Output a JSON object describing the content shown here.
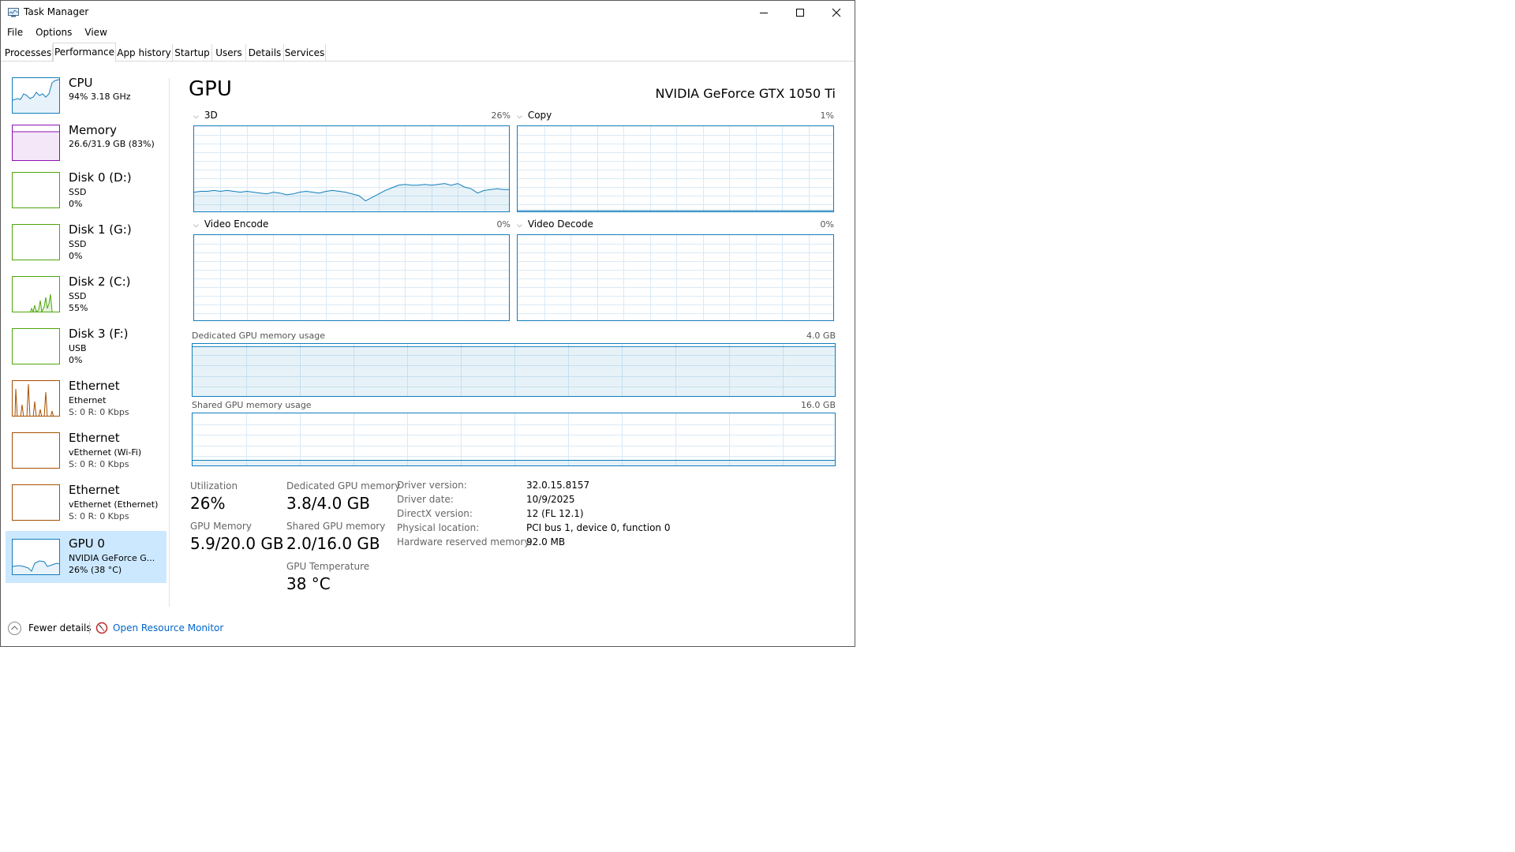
{
  "window": {
    "title": "Task Manager",
    "accent_color": "#117dbb",
    "icons": {
      "app": "task-manager-icon",
      "minimize": "minimize-icon",
      "maximize": "maximize-icon",
      "close": "close-icon"
    }
  },
  "menu": {
    "items": [
      "File",
      "Options",
      "View"
    ]
  },
  "tabs": {
    "items": [
      "Processes",
      "Performance",
      "App history",
      "Startup",
      "Users",
      "Details",
      "Services"
    ],
    "active": "Performance"
  },
  "sidebar": {
    "items": [
      {
        "title": "CPU",
        "sub1": "94%  3.18 GHz",
        "color": "#117dbb",
        "selected": false
      },
      {
        "title": "Memory",
        "sub1": "26.6/31.9 GB (83%)",
        "color": "#8b12ae",
        "selected": false
      },
      {
        "title": "Disk 0 (D:)",
        "sub1": "SSD",
        "sub2": "0%",
        "color": "#4da60c",
        "selected": false
      },
      {
        "title": "Disk 1 (G:)",
        "sub1": "SSD",
        "sub2": "0%",
        "color": "#4da60c",
        "selected": false
      },
      {
        "title": "Disk 2 (C:)",
        "sub1": "SSD",
        "sub2": "55%",
        "color": "#4da60c",
        "selected": false
      },
      {
        "title": "Disk 3 (F:)",
        "sub1": "USB",
        "sub2": "0%",
        "color": "#4da60c",
        "selected": false
      },
      {
        "title": "Ethernet",
        "sub1": "Ethernet",
        "sub2": "S: 0  R: 0 Kbps",
        "color": "#a74f01",
        "selected": false
      },
      {
        "title": "Ethernet",
        "sub1": "vEthernet (Wi-Fi)",
        "sub2": "S: 0  R: 0 Kbps",
        "color": "#a74f01",
        "selected": false
      },
      {
        "title": "Ethernet",
        "sub1": "vEthernet (Ethernet)",
        "sub2": "S: 0  R: 0 Kbps",
        "color": "#a74f01",
        "selected": false
      },
      {
        "title": "GPU 0",
        "sub1": "NVIDIA GeForce G...",
        "sub2": "26%  (38 °C)",
        "color": "#117dbb",
        "selected": true
      }
    ]
  },
  "main": {
    "title": "GPU",
    "gpu_name": "NVIDIA GeForce GTX 1050 Ti",
    "engines": [
      {
        "label": "3D",
        "percent": "26%"
      },
      {
        "label": "Copy",
        "percent": "1%"
      },
      {
        "label": "Video Encode",
        "percent": "0%"
      },
      {
        "label": "Video Decode",
        "percent": "0%"
      }
    ],
    "dedicated": {
      "label": "Dedicated GPU memory usage",
      "max": "4.0 GB",
      "fill_fraction": 0.95
    },
    "shared": {
      "label": "Shared GPU memory usage",
      "max": "16.0 GB",
      "fill_fraction": 0.125
    },
    "stats": {
      "utilization": {
        "label": "Utilization",
        "value": "26%"
      },
      "dedicated_mem": {
        "label": "Dedicated GPU memory",
        "value": "3.8/4.0 GB"
      },
      "gpu_memory": {
        "label": "GPU Memory",
        "value": "5.9/20.0 GB"
      },
      "shared_mem": {
        "label": "Shared GPU memory",
        "value": "2.0/16.0 GB"
      },
      "temperature": {
        "label": "GPU Temperature",
        "value": "38 °C"
      }
    },
    "info": [
      {
        "key": "Driver version:",
        "value": "32.0.15.8157"
      },
      {
        "key": "Driver date:",
        "value": "10/9/2025"
      },
      {
        "key": "DirectX version:",
        "value": "12 (FL 12.1)"
      },
      {
        "key": "Physical location:",
        "value": "PCI bus 1, device 0, function 0"
      },
      {
        "key": "Hardware reserved memory:",
        "value": "92.0 MB"
      }
    ]
  },
  "footer": {
    "fewer_details": "Fewer details",
    "open_resource_monitor": "Open Resource Monitor"
  },
  "chart_data": {
    "type": "line",
    "title": "3D",
    "ylim": [
      0,
      100
    ],
    "values": [
      24,
      25,
      25,
      26,
      25,
      26,
      25,
      24,
      25,
      24,
      23,
      22,
      24,
      23,
      21,
      22,
      24,
      25,
      24,
      23,
      25,
      26,
      25,
      24,
      22,
      20,
      14,
      18,
      22,
      26,
      29,
      32,
      33,
      32,
      32,
      33,
      32,
      33,
      34,
      32,
      34,
      30,
      28,
      23,
      26,
      27,
      28,
      27,
      27
    ]
  }
}
